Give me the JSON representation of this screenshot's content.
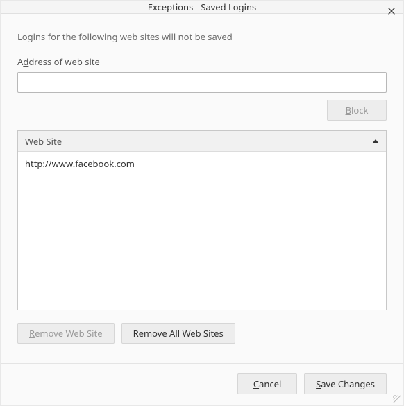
{
  "titlebar": {
    "title": "Exceptions - Saved Logins"
  },
  "desc": "Logins for the following web sites will not be saved",
  "address": {
    "label_pre": "A",
    "label_ul": "d",
    "label_post": "dress of web site",
    "value": ""
  },
  "buttons": {
    "block_ul": "B",
    "block_post": "lock",
    "remove_site_ul": "R",
    "remove_site_post": "emove Web Site",
    "remove_all": "Remove All Web Sites",
    "cancel_ul": "C",
    "cancel_post": "ancel",
    "save_ul": "S",
    "save_post": "ave Changes"
  },
  "table": {
    "header": "Web Site",
    "rows": [
      "http://www.facebook.com"
    ]
  }
}
